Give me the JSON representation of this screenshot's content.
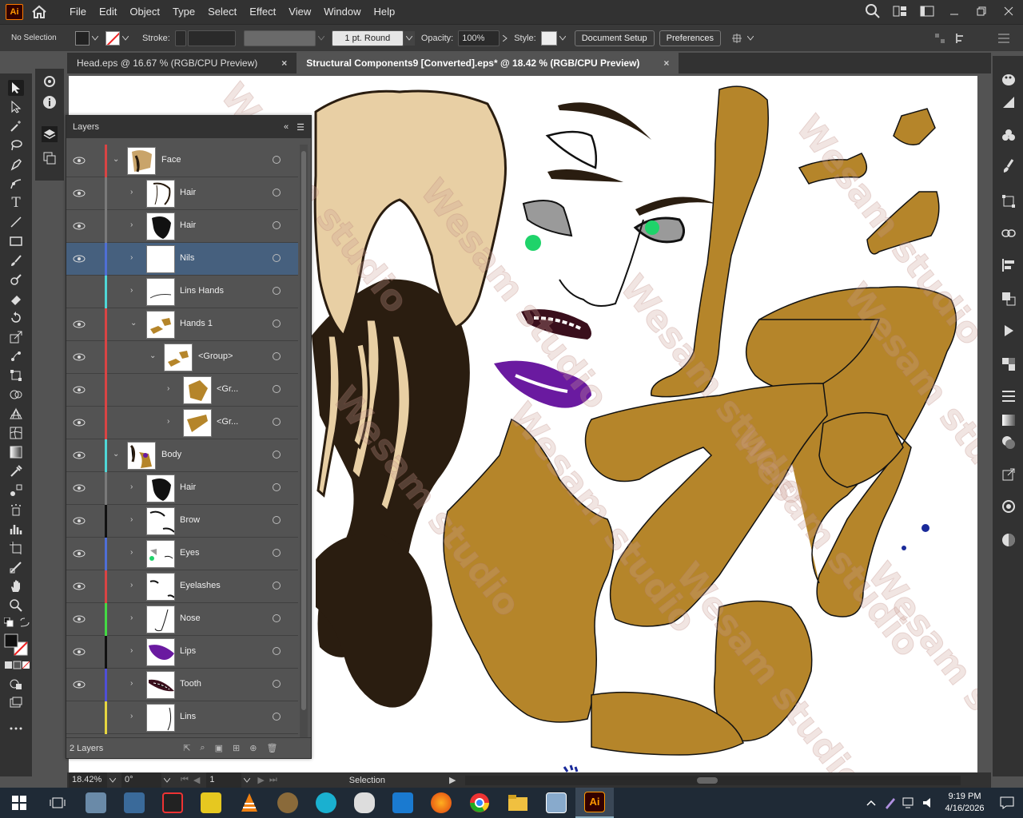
{
  "app": {
    "logo": "Ai"
  },
  "menu": [
    "File",
    "Edit",
    "Object",
    "Type",
    "Select",
    "Effect",
    "View",
    "Window",
    "Help"
  ],
  "control": {
    "selection": "No Selection",
    "stroke_label": "Stroke:",
    "stroke_profile": "1 pt. Round",
    "opacity_label": "Opacity:",
    "opacity": "100%",
    "style_label": "Style:",
    "document_setup": "Document Setup",
    "preferences": "Preferences"
  },
  "tabs": [
    {
      "title": "Head.eps @ 16.67 % (RGB/CPU Preview)",
      "close": "×"
    },
    {
      "title": "Structural Components9 [Converted].eps* @ 18.42 % (RGB/CPU Preview)",
      "close": "×"
    }
  ],
  "layers_panel": {
    "title": "Layers",
    "rows": [
      {
        "name": "Face",
        "color": "#d94444"
      },
      {
        "name": "Hair",
        "color": "#7a7a7a"
      },
      {
        "name": "Hair",
        "color": "#7a7a7a"
      },
      {
        "name": "Nils",
        "color": "#4f6fd6"
      },
      {
        "name": "Lins Hands",
        "color": "#4fd6d6"
      },
      {
        "name": "Hands 1",
        "color": "#d94444"
      },
      {
        "name": "<Group>",
        "color": "#d94444"
      },
      {
        "name": "<Gr...",
        "color": "#d94444"
      },
      {
        "name": "<Gr...",
        "color": "#d94444"
      },
      {
        "name": "Body",
        "color": "#4fd6d6"
      },
      {
        "name": "Hair",
        "color": "#7a7a7a"
      },
      {
        "name": "Brow",
        "color": "#111111"
      },
      {
        "name": "Eyes",
        "color": "#4f6fd6"
      },
      {
        "name": "Eyelashes",
        "color": "#d94444"
      },
      {
        "name": "Nose",
        "color": "#44d944"
      },
      {
        "name": "Lips",
        "color": "#111111"
      },
      {
        "name": "Tooth",
        "color": "#4f4fd6"
      },
      {
        "name": "Lins",
        "color": "#e6d640"
      }
    ],
    "footer": "2 Layers"
  },
  "status": {
    "zoom": "18.42%",
    "rotation": "0°",
    "artboard": "1",
    "tool": "Selection"
  },
  "taskbar": {
    "time": "9:19 PM",
    "date": "4/16/2026"
  },
  "watermark": "Wesam studio",
  "colors": {
    "skin": "#b5852a",
    "hair_dark": "#2a1d10",
    "lips": "#6a1aa0",
    "eye_green": "#1fd36a"
  }
}
